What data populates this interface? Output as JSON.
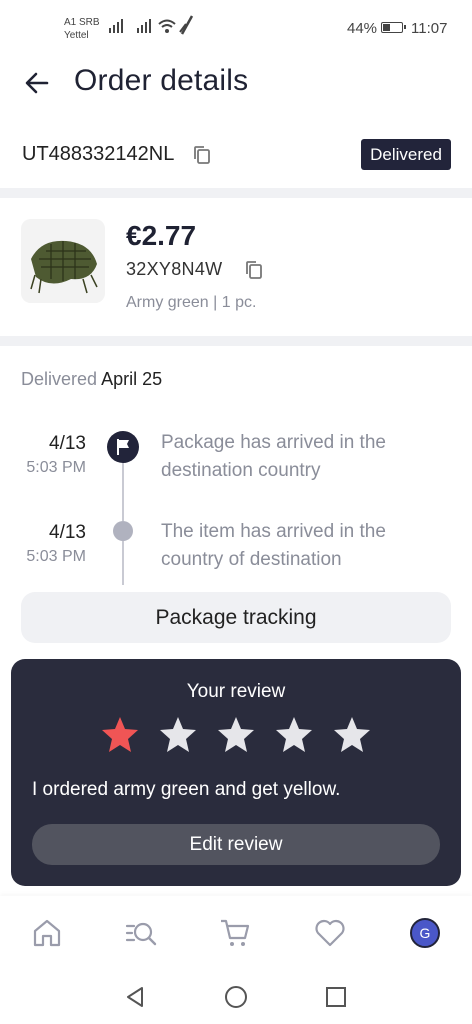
{
  "status_bar": {
    "carrier_line1": "A1 SRB",
    "carrier_line2": "Yettel",
    "battery_percent": "44%",
    "battery_level": 0.44,
    "time": "11:07"
  },
  "header": {
    "title": "Order details"
  },
  "order": {
    "number": "UT488332142NL",
    "status": "Delivered"
  },
  "product": {
    "price": "€2.77",
    "code": "32XY8N4W",
    "variant": "Army green | 1 pc."
  },
  "delivery": {
    "label": "Delivered",
    "date": "April 25",
    "events": [
      {
        "date": "4/13",
        "time": "5:03 PM",
        "text": "Package has arrived in the destination country"
      },
      {
        "date": "4/13",
        "time": "5:03 PM",
        "text": "The item has arrived in the country of destination"
      }
    ],
    "tracking_button": "Package tracking"
  },
  "review": {
    "title": "Your review",
    "rating": 1,
    "max_rating": 5,
    "star_filled_color": "#f05555",
    "star_empty_color": "#e6e6ea",
    "text": "I ordered army green and get yellow.",
    "edit_button": "Edit review"
  },
  "bottom_nav": {
    "items": [
      "home-icon",
      "search-list-icon",
      "cart-icon",
      "heart-icon",
      "profile-avatar"
    ],
    "avatar_initial": "G"
  }
}
